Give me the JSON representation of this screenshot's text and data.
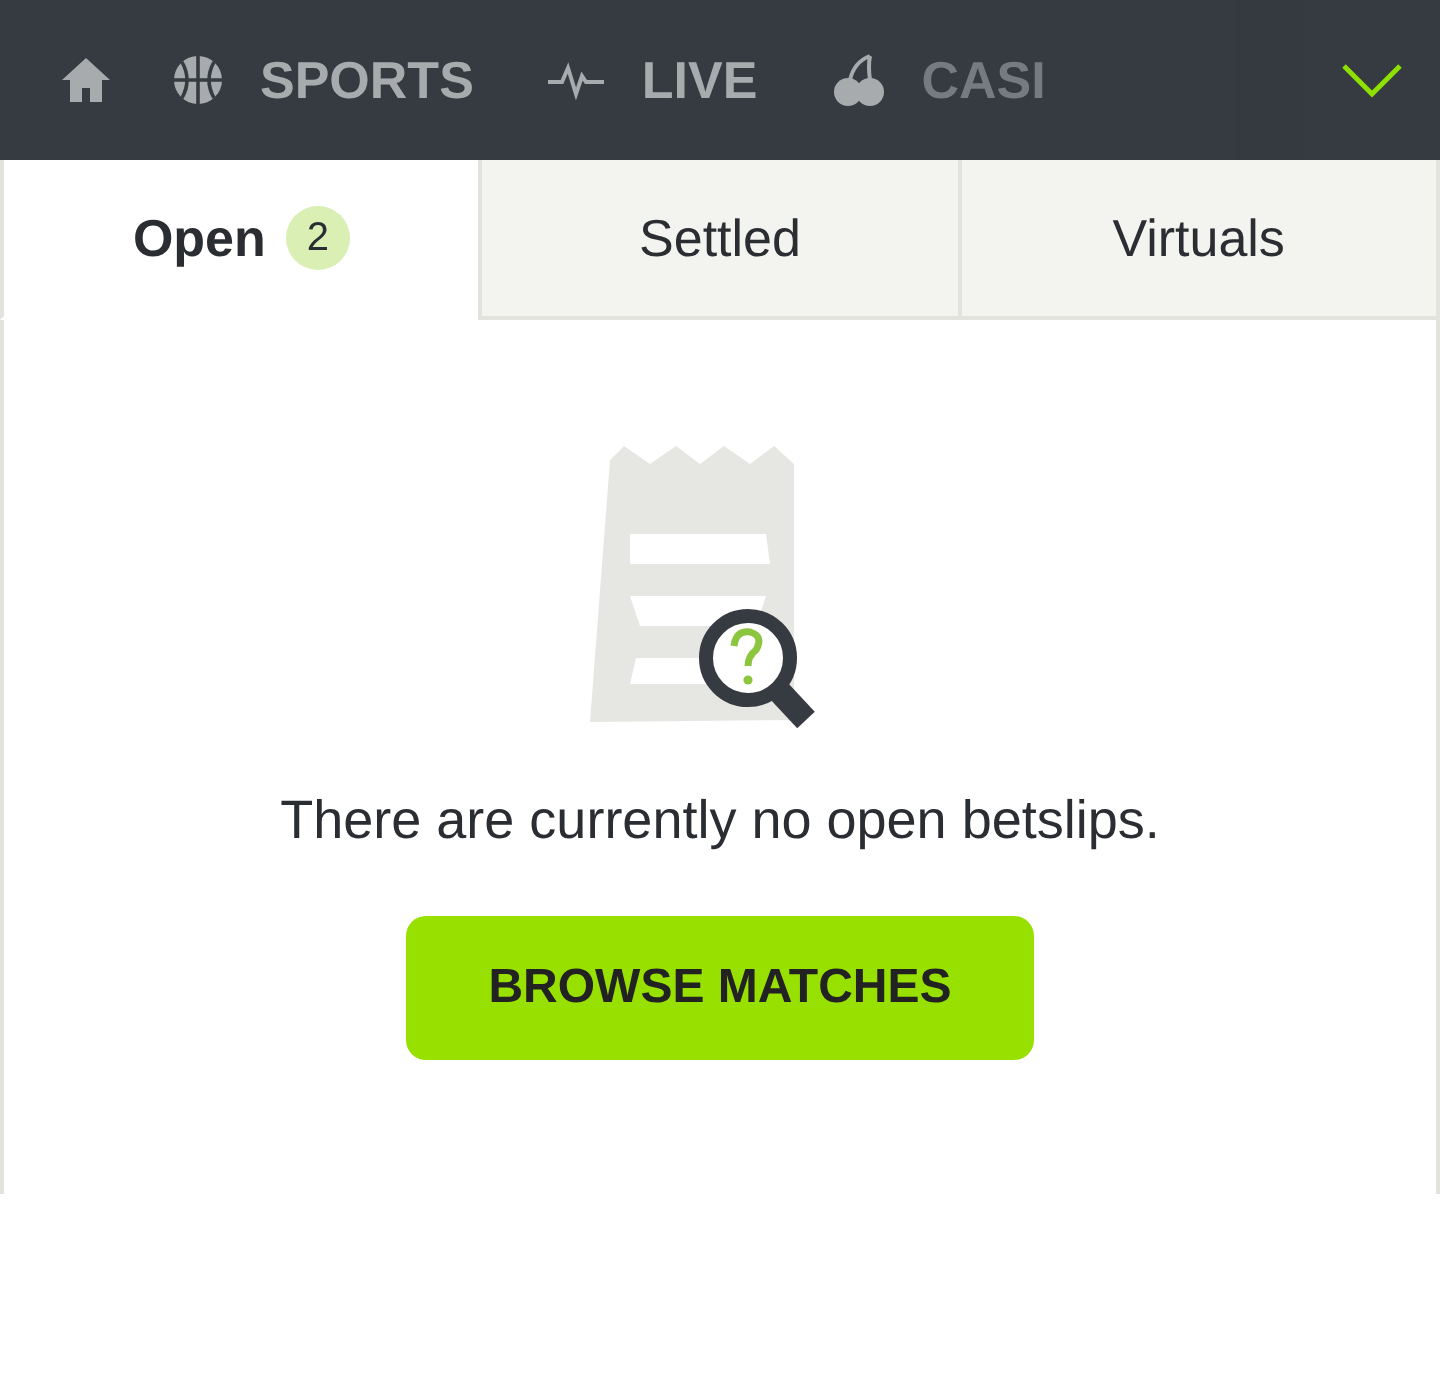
{
  "nav": {
    "items": [
      {
        "label": "SPORTS"
      },
      {
        "label": "LIVE"
      },
      {
        "label": "CASI"
      }
    ]
  },
  "tabs": [
    {
      "label": "Open",
      "count": "2",
      "selected": true
    },
    {
      "label": "Settled",
      "selected": false
    },
    {
      "label": "Virtuals",
      "selected": false
    }
  ],
  "empty_state": {
    "message": "There are currently no open betslips.",
    "button": "BROWSE MATCHES"
  }
}
